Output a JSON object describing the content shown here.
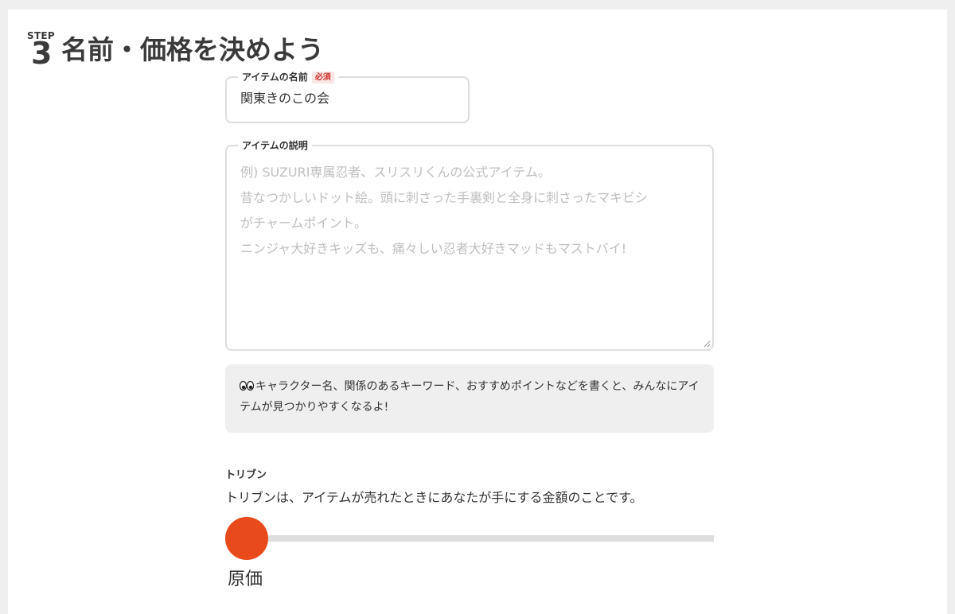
{
  "step": {
    "label": "STEP",
    "number": "3",
    "title": "名前・価格を決めよう"
  },
  "item_name": {
    "legend": "アイテムの名前",
    "required_label": "必須",
    "value": "関東きのこの会"
  },
  "item_description": {
    "legend": "アイテムの説明",
    "placeholder_lines": [
      "例) SUZURI専属忍者、スリスリくんの公式アイテム。",
      "昔なつかしいドット絵。頭に刺さった手裏剣と全身に刺さったマキビシ",
      "がチャームポイント。",
      "ニンジャ大好きキッズも、痛々しい忍者大好きマッドもマストバイ!"
    ]
  },
  "hint": {
    "icon": "eyes-icon",
    "text": "キャラクター名、関係のあるキーワード、おすすめポイントなどを書くと、みんなにアイテムが見つかりやすくなるよ!"
  },
  "toribun": {
    "label": "トリブン",
    "description": "トリブンは、アイテムが売れたときにあなたが手にする金額のことです。",
    "slider_fraction": 0,
    "slider_value_label": "原価"
  },
  "colors": {
    "accent": "#e84a1b",
    "required_text": "#d0342c",
    "required_bg": "#fbe6e6",
    "border": "#dddddd",
    "placeholder": "#bfbfbf",
    "hint_bg": "#efefef"
  }
}
